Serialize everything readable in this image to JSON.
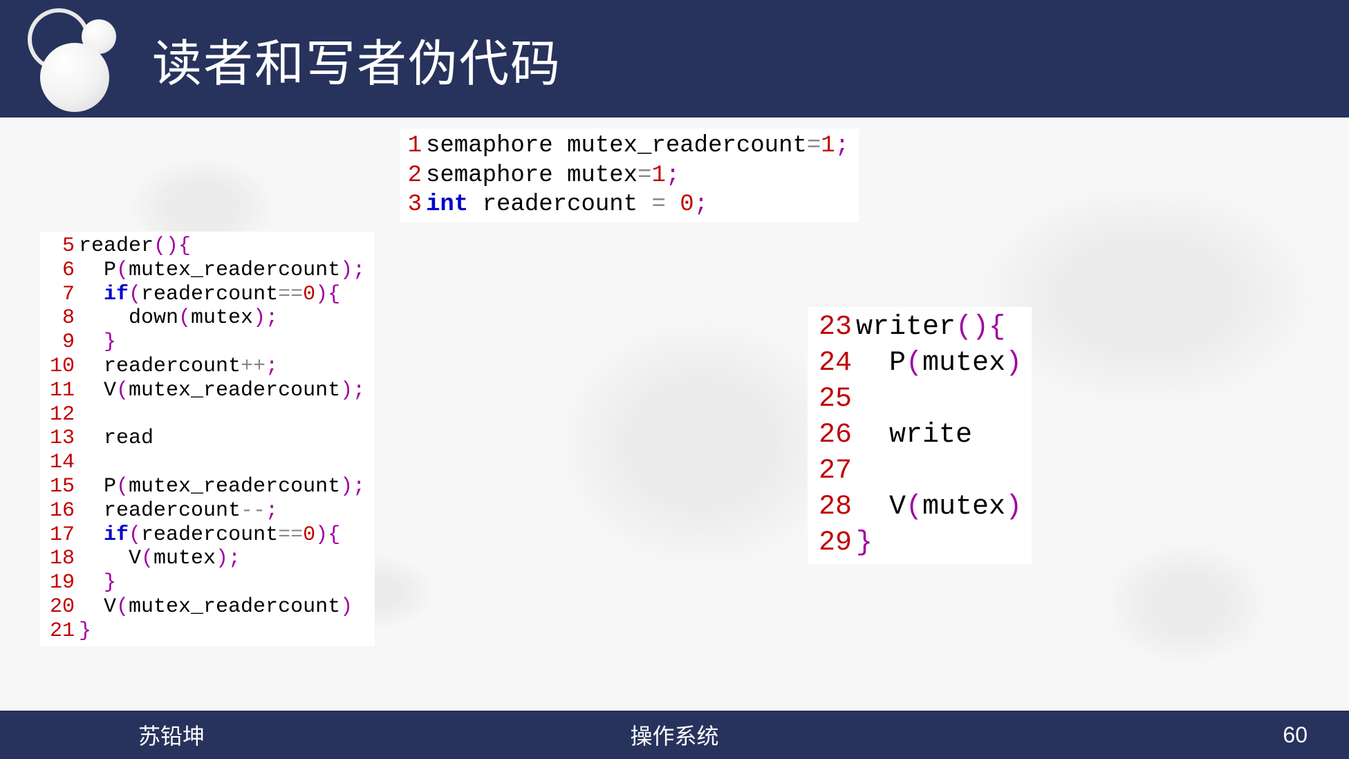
{
  "header": {
    "title": "读者和写者伪代码"
  },
  "code_top": {
    "lines": [
      {
        "n": "1",
        "tokens": [
          [
            "",
            "semaphore mutex_readercount"
          ],
          [
            "op",
            "="
          ],
          [
            "num",
            "1"
          ],
          [
            "punct",
            ";"
          ]
        ]
      },
      {
        "n": "2",
        "tokens": [
          [
            "",
            "semaphore mutex"
          ],
          [
            "op",
            "="
          ],
          [
            "num",
            "1"
          ],
          [
            "punct",
            ";"
          ]
        ]
      },
      {
        "n": "3",
        "tokens": [
          [
            "kw",
            "int"
          ],
          [
            "",
            " readercount "
          ],
          [
            "op",
            "="
          ],
          [
            "",
            " "
          ],
          [
            "num",
            "0"
          ],
          [
            "punct",
            ";"
          ]
        ]
      }
    ]
  },
  "code_left": {
    "lines": [
      {
        "n": "5",
        "tokens": [
          [
            "",
            "reader"
          ],
          [
            "punct",
            "(){"
          ]
        ]
      },
      {
        "n": "6",
        "tokens": [
          [
            "",
            "  P"
          ],
          [
            "punct",
            "("
          ],
          [
            "",
            "mutex_readercount"
          ],
          [
            "punct",
            ");"
          ]
        ]
      },
      {
        "n": "7",
        "tokens": [
          [
            "",
            "  "
          ],
          [
            "kw",
            "if"
          ],
          [
            "punct",
            "("
          ],
          [
            "",
            "readercount"
          ],
          [
            "op",
            "=="
          ],
          [
            "num",
            "0"
          ],
          [
            "punct",
            "){"
          ]
        ]
      },
      {
        "n": "8",
        "tokens": [
          [
            "",
            "    down"
          ],
          [
            "punct",
            "("
          ],
          [
            "",
            "mutex"
          ],
          [
            "punct",
            ");"
          ]
        ]
      },
      {
        "n": "9",
        "tokens": [
          [
            "",
            "  "
          ],
          [
            "punct",
            "}"
          ]
        ]
      },
      {
        "n": "10",
        "tokens": [
          [
            "",
            "  readercount"
          ],
          [
            "op",
            "++"
          ],
          [
            "punct",
            ";"
          ]
        ]
      },
      {
        "n": "11",
        "tokens": [
          [
            "",
            "  V"
          ],
          [
            "punct",
            "("
          ],
          [
            "",
            "mutex_readercount"
          ],
          [
            "punct",
            ");"
          ]
        ]
      },
      {
        "n": "12",
        "tokens": [
          [
            "",
            ""
          ]
        ]
      },
      {
        "n": "13",
        "tokens": [
          [
            "",
            "  read"
          ]
        ]
      },
      {
        "n": "14",
        "tokens": [
          [
            "",
            ""
          ]
        ]
      },
      {
        "n": "15",
        "tokens": [
          [
            "",
            "  P"
          ],
          [
            "punct",
            "("
          ],
          [
            "",
            "mutex_readercount"
          ],
          [
            "punct",
            ");"
          ]
        ]
      },
      {
        "n": "16",
        "tokens": [
          [
            "",
            "  readercount"
          ],
          [
            "op",
            "--"
          ],
          [
            "punct",
            ";"
          ]
        ]
      },
      {
        "n": "17",
        "tokens": [
          [
            "",
            "  "
          ],
          [
            "kw",
            "if"
          ],
          [
            "punct",
            "("
          ],
          [
            "",
            "readercount"
          ],
          [
            "op",
            "=="
          ],
          [
            "num",
            "0"
          ],
          [
            "punct",
            "){"
          ]
        ]
      },
      {
        "n": "18",
        "tokens": [
          [
            "",
            "    V"
          ],
          [
            "punct",
            "("
          ],
          [
            "",
            "mutex"
          ],
          [
            "punct",
            ");"
          ]
        ]
      },
      {
        "n": "19",
        "tokens": [
          [
            "",
            "  "
          ],
          [
            "punct",
            "}"
          ]
        ]
      },
      {
        "n": "20",
        "tokens": [
          [
            "",
            "  V"
          ],
          [
            "punct",
            "("
          ],
          [
            "",
            "mutex_readercount"
          ],
          [
            "punct",
            ")"
          ]
        ]
      },
      {
        "n": "21",
        "tokens": [
          [
            "punct",
            "}"
          ]
        ]
      }
    ]
  },
  "code_right": {
    "lines": [
      {
        "n": "23",
        "tokens": [
          [
            "",
            "writer"
          ],
          [
            "punct",
            "(){"
          ]
        ]
      },
      {
        "n": "24",
        "tokens": [
          [
            "",
            "  P"
          ],
          [
            "punct",
            "("
          ],
          [
            "",
            "mutex"
          ],
          [
            "punct",
            ")"
          ]
        ]
      },
      {
        "n": "25",
        "tokens": [
          [
            "",
            ""
          ]
        ]
      },
      {
        "n": "26",
        "tokens": [
          [
            "",
            "  write"
          ]
        ]
      },
      {
        "n": "27",
        "tokens": [
          [
            "",
            ""
          ]
        ]
      },
      {
        "n": "28",
        "tokens": [
          [
            "",
            "  V"
          ],
          [
            "punct",
            "("
          ],
          [
            "",
            "mutex"
          ],
          [
            "punct",
            ")"
          ]
        ]
      },
      {
        "n": "29",
        "tokens": [
          [
            "punct",
            "}"
          ]
        ]
      }
    ]
  },
  "footer": {
    "author": "苏铅坤",
    "course": "操作系统",
    "page": "60"
  }
}
